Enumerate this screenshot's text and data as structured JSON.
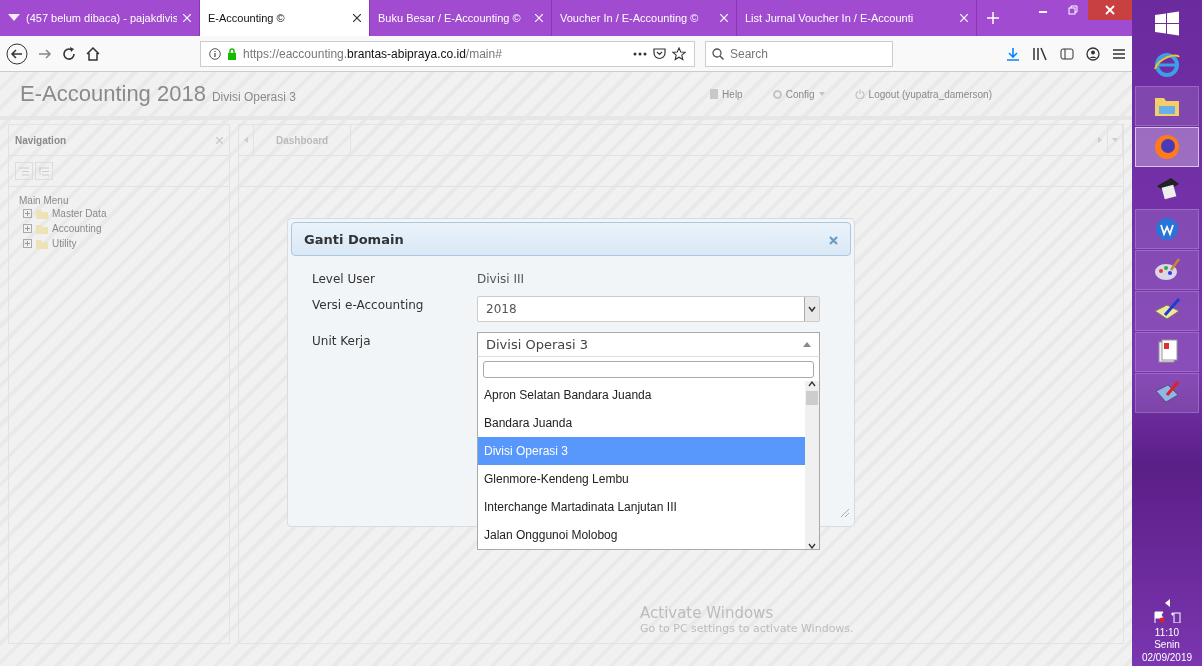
{
  "browser": {
    "tabs": [
      {
        "title": "(457 belum dibaca) - pajakdivis",
        "selected": false,
        "kind": "mail"
      },
      {
        "title": "E-Accounting ©",
        "selected": true,
        "kind": "page"
      },
      {
        "title": "Buku Besar / E-Accounting ©",
        "selected": false,
        "kind": "page"
      },
      {
        "title": "Voucher In / E-Accounting ©",
        "selected": false,
        "kind": "page"
      },
      {
        "title": "List Jurnal Voucher In / E-Accounti",
        "selected": false,
        "kind": "page"
      }
    ],
    "url": {
      "prefix": "https://eaccounting.",
      "domain": "brantas-abipraya.co.id",
      "path": "/main#"
    },
    "search": {
      "placeholder": "Search"
    }
  },
  "app": {
    "title": "E-Accounting 2018",
    "subtitle": "Divisi Operasi 3",
    "menu": [
      "Help",
      "Config",
      "Logout (yupatra_damerson)"
    ]
  },
  "navigation": {
    "title": "Navigation",
    "menu_label": "Main Menu",
    "items": [
      {
        "label": "Master Data",
        "expanded": false
      },
      {
        "label": "Accounting",
        "expanded": false
      },
      {
        "label": "Utility",
        "expanded": false
      }
    ]
  },
  "content_tabs": [
    {
      "label": "Dashboard",
      "selected": true
    }
  ],
  "dialog": {
    "title": "Ganti Domain",
    "fields": [
      {
        "label": "Level User",
        "kind": "text",
        "value": "Divisi III"
      },
      {
        "label": "Versi e-Accounting",
        "kind": "select",
        "value": "2018"
      },
      {
        "label": "Unit Kerja",
        "kind": "combo",
        "value": "Divisi Operasi 3",
        "expanded": true,
        "options": [
          {
            "label": "Apron Selatan Bandara Juanda",
            "selected": false
          },
          {
            "label": "Bandara Juanda",
            "selected": false
          },
          {
            "label": "Divisi Operasi 3",
            "selected": true
          },
          {
            "label": "Glenmore-Kendeng Lembu",
            "selected": false
          },
          {
            "label": "Interchange Martadinata Lanjutan III",
            "selected": false
          },
          {
            "label": "Jalan Onggunoi Molobog",
            "selected": false
          }
        ]
      }
    ]
  },
  "activation": {
    "title": "Activate Windows",
    "text": "Go to PC settings to activate Windows."
  },
  "taskbar": {
    "time": "11:10",
    "day": "Senin",
    "date": "02/09/2019"
  }
}
